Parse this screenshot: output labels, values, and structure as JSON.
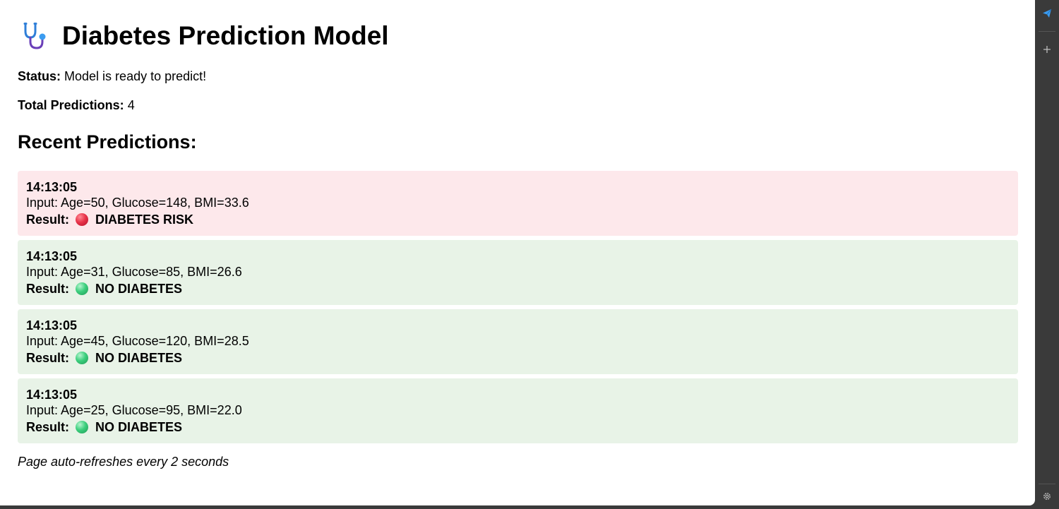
{
  "header": {
    "title": "Diabetes Prediction Model",
    "icon": "stethoscope-icon"
  },
  "status": {
    "label": "Status:",
    "value": "Model is ready to predict!"
  },
  "total": {
    "label": "Total Predictions:",
    "value": "4"
  },
  "recent_heading": "Recent Predictions:",
  "predictions": [
    {
      "time": "14:13:05",
      "input": "Input: Age=50, Glucose=148, BMI=33.6",
      "result_label": "Result:",
      "result": "DIABETES RISK",
      "kind": "risk"
    },
    {
      "time": "14:13:05",
      "input": "Input: Age=31, Glucose=85, BMI=26.6",
      "result_label": "Result:",
      "result": "NO DIABETES",
      "kind": "ok"
    },
    {
      "time": "14:13:05",
      "input": "Input: Age=45, Glucose=120, BMI=28.5",
      "result_label": "Result:",
      "result": "NO DIABETES",
      "kind": "ok"
    },
    {
      "time": "14:13:05",
      "input": "Input: Age=25, Glucose=95, BMI=22.0",
      "result_label": "Result:",
      "result": "NO DIABETES",
      "kind": "ok"
    }
  ],
  "footer_note": "Page auto-refreshes every 2 seconds",
  "colors": {
    "risk_bg": "#fde8eb",
    "ok_bg": "#e8f3e7",
    "risk_dot": "#e8344a",
    "ok_dot": "#3ccf7d",
    "accent": "#3b9cf0"
  },
  "sidebar_icons": [
    "send-icon",
    "plus-icon",
    "gear-icon"
  ]
}
